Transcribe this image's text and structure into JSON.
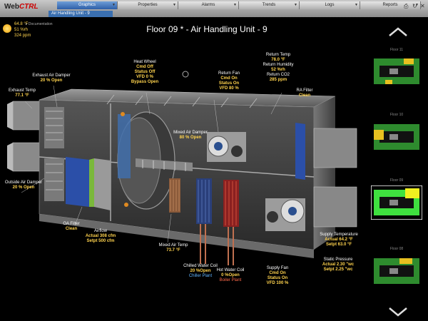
{
  "app": {
    "logo_main": "Web",
    "logo_sub": "CTRL",
    "breadcrumb": "Air Handling Unit - 9"
  },
  "nav": {
    "tabs": [
      {
        "label": "Graphics",
        "active": true
      },
      {
        "label": "Properties",
        "active": false
      },
      {
        "label": "Alarms",
        "active": false
      },
      {
        "label": "Trends",
        "active": false
      },
      {
        "label": "Logs",
        "active": false
      },
      {
        "label": "Reports",
        "active": false
      }
    ]
  },
  "weather": {
    "temp": "64.8 °F",
    "humidity": "51 %rh",
    "co2": "324 ppm",
    "docs": "Documentation"
  },
  "page_title": "Floor 09 *    -    Air Handling Unit - 9",
  "labels": {
    "exhaust_air_damper": "Exhaust Air Damper",
    "exhaust_air_damper_val": "20 % Open",
    "exhaust_temp": "Exhaust Temp",
    "exhaust_temp_val": "77.1 °F",
    "heat_wheel": "Heat Wheel",
    "hw_cmd": "Cmd Off",
    "hw_status": "Status Off",
    "hw_vfd": "VFD 0 %",
    "hw_bypass": "Bypass Open",
    "return_fan": "Return Fan",
    "rf_cmd": "Cmd On",
    "rf_status": "Status On",
    "rf_vfd": "VFD 80 %",
    "return_temp": "Return Temp",
    "return_temp_val": "78.0 °F",
    "return_humidity": "Return Humidity",
    "return_humidity_val": "52 %rh",
    "return_co2": "Return CO2",
    "return_co2_val": "285 ppm",
    "ra_filter": "RA Filter",
    "ra_filter_val": "Clean",
    "mixed_air_damper": "Mixed Air Damper",
    "mixed_air_damper_val": "80 % Open",
    "outside_air_damper": "Outside Air Damper",
    "outside_air_damper_val": "20 % Open",
    "oa_filter": "OA Filter",
    "oa_filter_val": "Clean",
    "airflow": "Airflow",
    "airflow_actual": "Actual 308 cfm",
    "airflow_setpt": "Setpt 500 cfm",
    "mixed_air_temp": "Mixed Air Temp",
    "mixed_air_temp_val": "73.7 °F",
    "chilled_water_coil": "Chilled Water Coil",
    "cwc_val": "20 %Open",
    "cwc_plant": "Chiller Plant",
    "hot_water_coil": "Hot Water Coil",
    "hwc_val": "0 %Open",
    "hwc_plant": "Boiler Plant",
    "supply_fan": "Supply Fan",
    "sf_cmd": "Cmd On",
    "sf_status": "Status On",
    "sf_vfd": "VFD 100 %",
    "supply_temp": "Supply Temperature",
    "supply_temp_actual": "Actual 64.2 °F",
    "supply_temp_setpt": "Setpt 63.0 °F",
    "static_pressure": "Static Pressure",
    "sp_actual": "Actual 2.30 \"wc",
    "sp_setpt": "Setpt 2.25 \"wc"
  },
  "floors": [
    {
      "label": "Floor 11"
    },
    {
      "label": "Floor 10"
    },
    {
      "label": "Floor 09"
    },
    {
      "label": "Floor 08"
    }
  ],
  "colors": {
    "accent": "#2d5ea8",
    "value": "#ffd34d",
    "ok": "#7cf07c",
    "plant": "#5fb4ff",
    "boiler": "#ff6a4a"
  }
}
